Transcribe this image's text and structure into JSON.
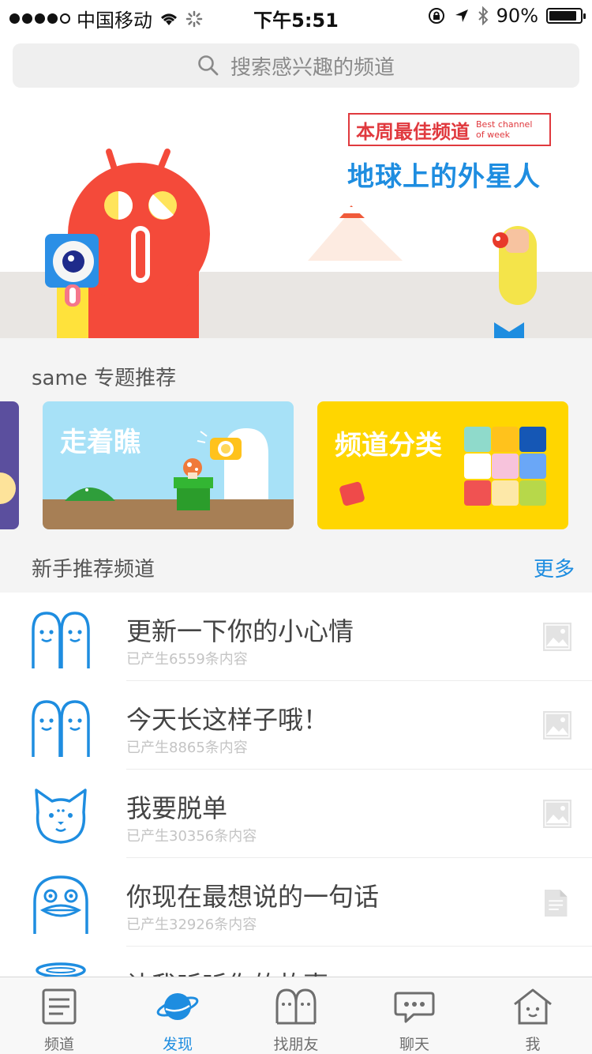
{
  "status_bar": {
    "carrier": "中国移动",
    "time": "下午5:51",
    "battery_percent": "90%",
    "battery_level": 0.9
  },
  "search": {
    "placeholder": "搜索感兴趣的频道"
  },
  "banner": {
    "badge_cn": "本周最佳频道",
    "badge_en_line1": "Best channel",
    "badge_en_line2": "of week",
    "title": "地球上的外星人"
  },
  "topics": {
    "header": "same 专题推荐",
    "cards": [
      {
        "label": "走着瞧",
        "color": "#a7e1f7"
      },
      {
        "label": "频道分类",
        "color": "#ffd600"
      }
    ]
  },
  "newbie": {
    "header": "新手推荐频道",
    "more": "更多",
    "items": [
      {
        "title": "更新一下你的小心情",
        "sub": "已产生6559条内容",
        "avatar": "twin-ghost-icon",
        "thumb": "image-icon"
      },
      {
        "title": "今天长这样子哦！",
        "sub": "已产生8865条内容",
        "avatar": "twin-ghost-icon",
        "thumb": "image-icon"
      },
      {
        "title": "我要脱单",
        "sub": "已产生30356条内容",
        "avatar": "cat-icon",
        "thumb": "image-icon"
      },
      {
        "title": "你现在最想说的一句话",
        "sub": "已产生32926条内容",
        "avatar": "duck-icon",
        "thumb": "document-icon"
      },
      {
        "title": "让我听听你的故事",
        "sub": "",
        "avatar": "halo-icon",
        "thumb": ""
      }
    ]
  },
  "tabbar": {
    "items": [
      {
        "label": "频道",
        "icon": "channel-list-icon"
      },
      {
        "label": "发现",
        "icon": "planet-icon",
        "active": true
      },
      {
        "label": "找朋友",
        "icon": "twin-ghost-icon"
      },
      {
        "label": "聊天",
        "icon": "chat-bubble-icon"
      },
      {
        "label": "我",
        "icon": "house-face-icon"
      }
    ]
  },
  "colors": {
    "accent": "#1e8de0",
    "badge_red": "#e0393e"
  }
}
